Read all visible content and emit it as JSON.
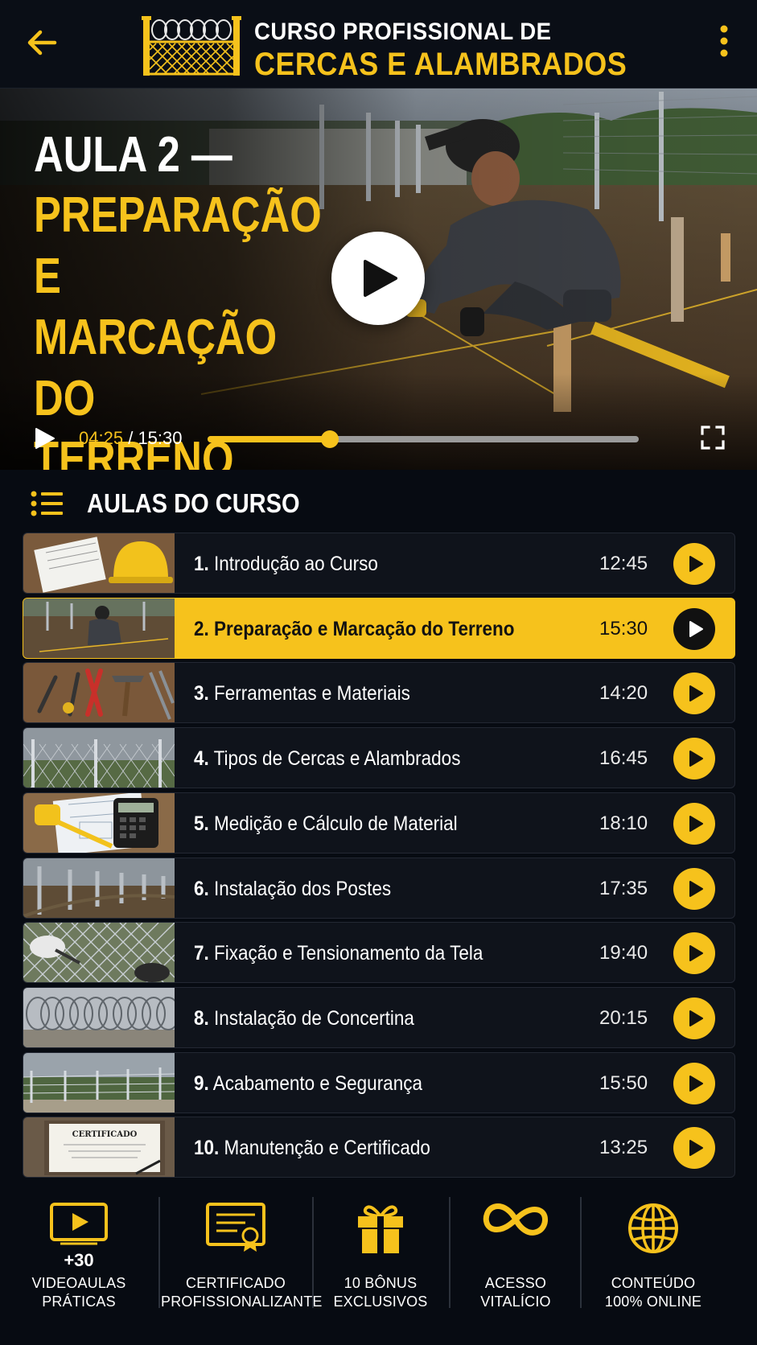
{
  "header": {
    "title_line1": "CURSO PROFISSIONAL DE",
    "title_line2": "CERCAS E ALAMBRADOS",
    "back_icon": "arrow-left-icon",
    "menu_icon": "more-vertical-icon",
    "logo": "barbed-wire-fence-logo"
  },
  "player": {
    "title_line1": "AULA 2 —",
    "title_line2": "PREPARAÇÃO\nE MARCAÇÃO\nDO TERRENO",
    "current_time": "04:25",
    "separator": "/",
    "total_time": "15:30",
    "progress_fraction": 0.284,
    "play_icon": "play-icon",
    "fullscreen_icon": "fullscreen-icon"
  },
  "lessons": {
    "heading": "AULAS DO CURSO",
    "heading_icon": "list-icon",
    "items": [
      {
        "num": "1.",
        "title": "Introdução ao Curso",
        "duration": "12:45",
        "active": false,
        "thumb": "notebook-helmet"
      },
      {
        "num": "2.",
        "title": "Preparação e Marcação do Terreno",
        "duration": "15:30",
        "active": true,
        "thumb": "worker-marking"
      },
      {
        "num": "3.",
        "title": "Ferramentas e Materiais",
        "duration": "14:20",
        "active": false,
        "thumb": "tools"
      },
      {
        "num": "4.",
        "title": "Tipos de Cercas e Alambrados",
        "duration": "16:45",
        "active": false,
        "thumb": "chain-fence"
      },
      {
        "num": "5.",
        "title": "Medição e Cálculo de Material",
        "duration": "18:10",
        "active": false,
        "thumb": "calculator-plans"
      },
      {
        "num": "6.",
        "title": "Instalação dos Postes",
        "duration": "17:35",
        "active": false,
        "thumb": "posts"
      },
      {
        "num": "7.",
        "title": "Fixação e Tensionamento da Tela",
        "duration": "19:40",
        "active": false,
        "thumb": "mesh-gloves"
      },
      {
        "num": "8.",
        "title": "Instalação de Concertina",
        "duration": "20:15",
        "active": false,
        "thumb": "concertina"
      },
      {
        "num": "9.",
        "title": "Acabamento e Segurança",
        "duration": "15:50",
        "active": false,
        "thumb": "finished-fence"
      },
      {
        "num": "10.",
        "title": "Manutenção e Certificado",
        "duration": "13:25",
        "active": false,
        "thumb": "certificate"
      }
    ]
  },
  "features": [
    {
      "icon": "video-play-icon",
      "number": "+30",
      "text": "VIDEOAULAS\nPRÁTICAS"
    },
    {
      "icon": "certificate-icon",
      "number": "",
      "text": "CERTIFICADO\nPROFISSIONALIZANTE"
    },
    {
      "icon": "gift-icon",
      "number": "",
      "text": "10 BÔNUS\nEXCLUSIVOS"
    },
    {
      "icon": "infinity-icon",
      "number": "",
      "text": "ACESSO\nVITALÍCIO"
    },
    {
      "icon": "globe-icon",
      "number": "",
      "text": "CONTEÚDO\n100% ONLINE"
    }
  ],
  "colors": {
    "accent": "#f6c21c",
    "background": "#070b12",
    "row_background": "#0f131b",
    "text": "#ffffff"
  }
}
